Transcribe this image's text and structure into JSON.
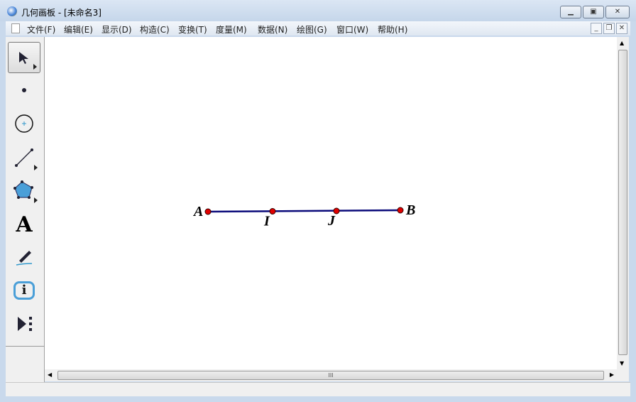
{
  "window": {
    "title": "几何画板 - [未命名3]"
  },
  "menu": [
    "文件(F)",
    "编辑(E)",
    "显示(D)",
    "构造(C)",
    "变换(T)",
    "度量(M)",
    "数据(N)",
    "绘图(G)",
    "窗口(W)",
    "帮助(H)"
  ],
  "tools": [
    "arrow-select-icon",
    "point-tool-icon",
    "compass-tool-icon",
    "straightedge-tool-icon",
    "polygon-tool-icon",
    "text-tool-icon",
    "marker-tool-icon",
    "information-tool-icon",
    "custom-tool-icon"
  ],
  "text_tool_glyph": "A",
  "info_glyph": "i",
  "canvas": {
    "line_color": "#0a0a7a",
    "point_color": "#e00000",
    "points": [
      {
        "label": "A"
      },
      {
        "label": "I"
      },
      {
        "label": "J"
      },
      {
        "label": "B"
      }
    ]
  },
  "hscroll_grip": "III"
}
